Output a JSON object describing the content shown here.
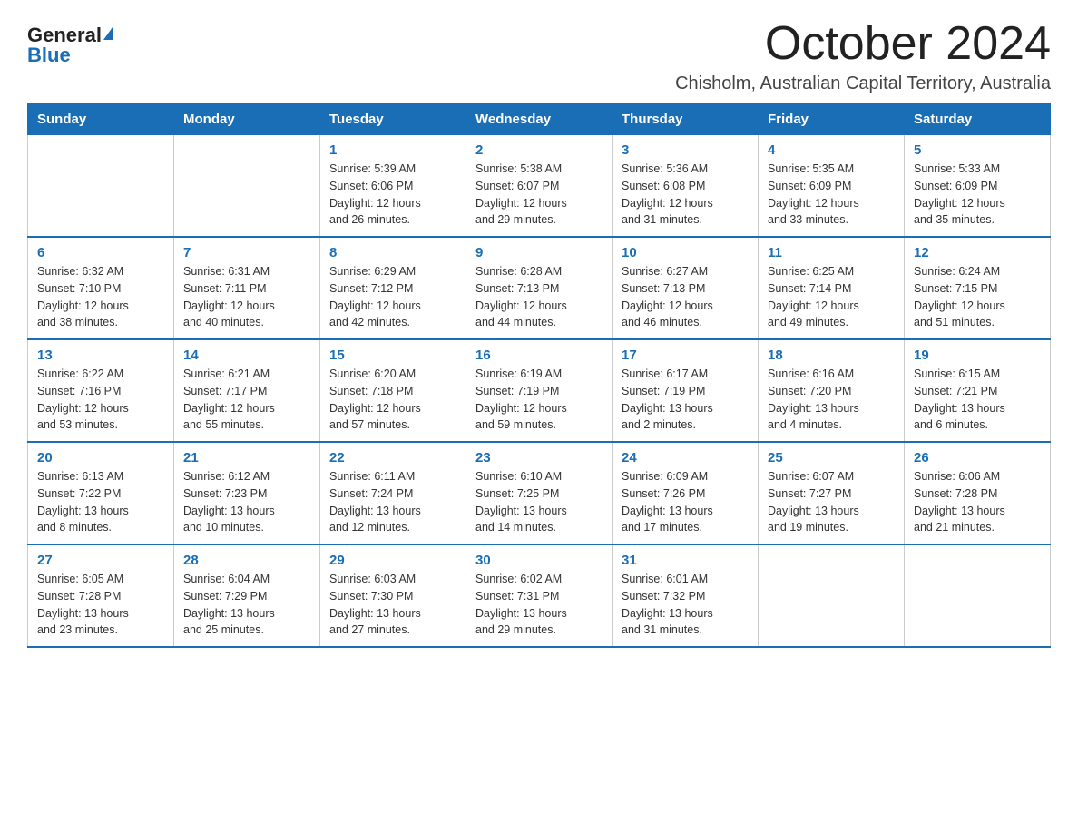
{
  "logo": {
    "general": "General",
    "blue": "Blue"
  },
  "title": "October 2024",
  "location": "Chisholm, Australian Capital Territory, Australia",
  "days_of_week": [
    "Sunday",
    "Monday",
    "Tuesday",
    "Wednesday",
    "Thursday",
    "Friday",
    "Saturday"
  ],
  "weeks": [
    [
      {
        "day": "",
        "info": ""
      },
      {
        "day": "",
        "info": ""
      },
      {
        "day": "1",
        "info": "Sunrise: 5:39 AM\nSunset: 6:06 PM\nDaylight: 12 hours\nand 26 minutes."
      },
      {
        "day": "2",
        "info": "Sunrise: 5:38 AM\nSunset: 6:07 PM\nDaylight: 12 hours\nand 29 minutes."
      },
      {
        "day": "3",
        "info": "Sunrise: 5:36 AM\nSunset: 6:08 PM\nDaylight: 12 hours\nand 31 minutes."
      },
      {
        "day": "4",
        "info": "Sunrise: 5:35 AM\nSunset: 6:09 PM\nDaylight: 12 hours\nand 33 minutes."
      },
      {
        "day": "5",
        "info": "Sunrise: 5:33 AM\nSunset: 6:09 PM\nDaylight: 12 hours\nand 35 minutes."
      }
    ],
    [
      {
        "day": "6",
        "info": "Sunrise: 6:32 AM\nSunset: 7:10 PM\nDaylight: 12 hours\nand 38 minutes."
      },
      {
        "day": "7",
        "info": "Sunrise: 6:31 AM\nSunset: 7:11 PM\nDaylight: 12 hours\nand 40 minutes."
      },
      {
        "day": "8",
        "info": "Sunrise: 6:29 AM\nSunset: 7:12 PM\nDaylight: 12 hours\nand 42 minutes."
      },
      {
        "day": "9",
        "info": "Sunrise: 6:28 AM\nSunset: 7:13 PM\nDaylight: 12 hours\nand 44 minutes."
      },
      {
        "day": "10",
        "info": "Sunrise: 6:27 AM\nSunset: 7:13 PM\nDaylight: 12 hours\nand 46 minutes."
      },
      {
        "day": "11",
        "info": "Sunrise: 6:25 AM\nSunset: 7:14 PM\nDaylight: 12 hours\nand 49 minutes."
      },
      {
        "day": "12",
        "info": "Sunrise: 6:24 AM\nSunset: 7:15 PM\nDaylight: 12 hours\nand 51 minutes."
      }
    ],
    [
      {
        "day": "13",
        "info": "Sunrise: 6:22 AM\nSunset: 7:16 PM\nDaylight: 12 hours\nand 53 minutes."
      },
      {
        "day": "14",
        "info": "Sunrise: 6:21 AM\nSunset: 7:17 PM\nDaylight: 12 hours\nand 55 minutes."
      },
      {
        "day": "15",
        "info": "Sunrise: 6:20 AM\nSunset: 7:18 PM\nDaylight: 12 hours\nand 57 minutes."
      },
      {
        "day": "16",
        "info": "Sunrise: 6:19 AM\nSunset: 7:19 PM\nDaylight: 12 hours\nand 59 minutes."
      },
      {
        "day": "17",
        "info": "Sunrise: 6:17 AM\nSunset: 7:19 PM\nDaylight: 13 hours\nand 2 minutes."
      },
      {
        "day": "18",
        "info": "Sunrise: 6:16 AM\nSunset: 7:20 PM\nDaylight: 13 hours\nand 4 minutes."
      },
      {
        "day": "19",
        "info": "Sunrise: 6:15 AM\nSunset: 7:21 PM\nDaylight: 13 hours\nand 6 minutes."
      }
    ],
    [
      {
        "day": "20",
        "info": "Sunrise: 6:13 AM\nSunset: 7:22 PM\nDaylight: 13 hours\nand 8 minutes."
      },
      {
        "day": "21",
        "info": "Sunrise: 6:12 AM\nSunset: 7:23 PM\nDaylight: 13 hours\nand 10 minutes."
      },
      {
        "day": "22",
        "info": "Sunrise: 6:11 AM\nSunset: 7:24 PM\nDaylight: 13 hours\nand 12 minutes."
      },
      {
        "day": "23",
        "info": "Sunrise: 6:10 AM\nSunset: 7:25 PM\nDaylight: 13 hours\nand 14 minutes."
      },
      {
        "day": "24",
        "info": "Sunrise: 6:09 AM\nSunset: 7:26 PM\nDaylight: 13 hours\nand 17 minutes."
      },
      {
        "day": "25",
        "info": "Sunrise: 6:07 AM\nSunset: 7:27 PM\nDaylight: 13 hours\nand 19 minutes."
      },
      {
        "day": "26",
        "info": "Sunrise: 6:06 AM\nSunset: 7:28 PM\nDaylight: 13 hours\nand 21 minutes."
      }
    ],
    [
      {
        "day": "27",
        "info": "Sunrise: 6:05 AM\nSunset: 7:28 PM\nDaylight: 13 hours\nand 23 minutes."
      },
      {
        "day": "28",
        "info": "Sunrise: 6:04 AM\nSunset: 7:29 PM\nDaylight: 13 hours\nand 25 minutes."
      },
      {
        "day": "29",
        "info": "Sunrise: 6:03 AM\nSunset: 7:30 PM\nDaylight: 13 hours\nand 27 minutes."
      },
      {
        "day": "30",
        "info": "Sunrise: 6:02 AM\nSunset: 7:31 PM\nDaylight: 13 hours\nand 29 minutes."
      },
      {
        "day": "31",
        "info": "Sunrise: 6:01 AM\nSunset: 7:32 PM\nDaylight: 13 hours\nand 31 minutes."
      },
      {
        "day": "",
        "info": ""
      },
      {
        "day": "",
        "info": ""
      }
    ]
  ]
}
